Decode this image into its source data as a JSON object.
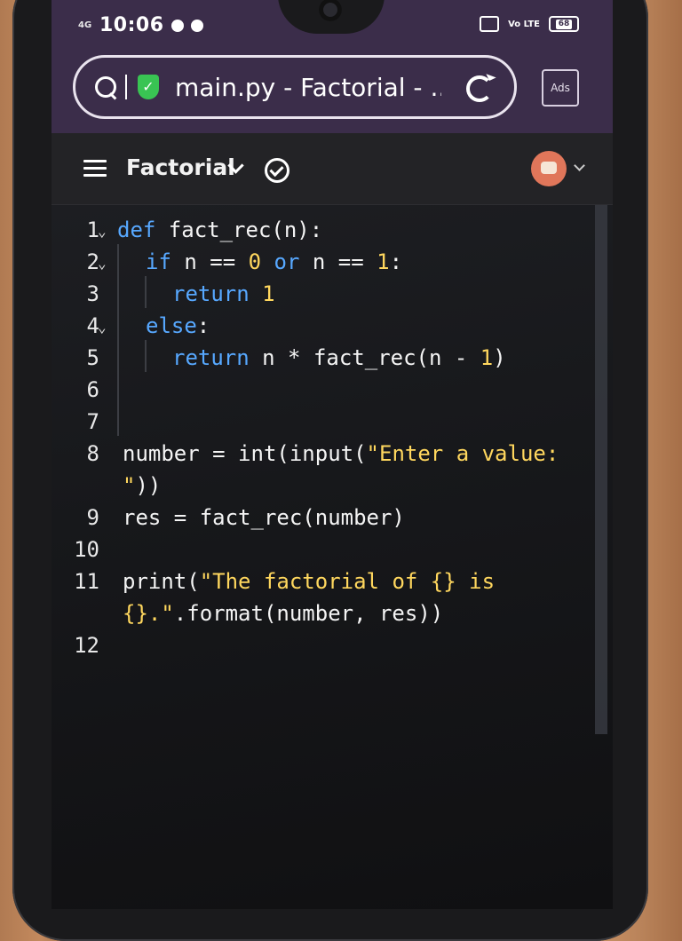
{
  "status_bar": {
    "network": "4G",
    "time": "10:06",
    "volte": "Vo LTE",
    "battery": "68"
  },
  "browser": {
    "url_text": "main.py - Factorial - ...",
    "ads_label": "Ads",
    "secure_icon": "shield-check-icon"
  },
  "app_header": {
    "project_title": "Factorial"
  },
  "colors": {
    "keyword": "#57a8ff",
    "string_number": "#ffd75e",
    "plain": "#f4f4f4"
  },
  "code_lines": [
    {
      "n": "1",
      "segments": [
        [
          "kw",
          "def "
        ],
        [
          "fn",
          "fact_rec(n):"
        ]
      ]
    },
    {
      "n": "2",
      "segments": [
        [
          "kw",
          "if "
        ],
        [
          "fn",
          "n == "
        ],
        [
          "nm",
          "0"
        ],
        [
          "kw",
          " or "
        ],
        [
          "fn",
          "n == "
        ],
        [
          "nm",
          "1"
        ],
        [
          "fn",
          ":"
        ]
      ]
    },
    {
      "n": "3",
      "segments": [
        [
          "kw",
          "return "
        ],
        [
          "nm",
          "1"
        ]
      ]
    },
    {
      "n": "4",
      "segments": [
        [
          "kw",
          "else"
        ],
        [
          "fn",
          ":"
        ]
      ]
    },
    {
      "n": "5",
      "segments": [
        [
          "kw",
          "return "
        ],
        [
          "fn",
          "n * fact_rec(n - "
        ],
        [
          "nm",
          "1"
        ],
        [
          "fn",
          ")"
        ]
      ]
    },
    {
      "n": "6",
      "segments": []
    },
    {
      "n": "7",
      "segments": []
    },
    {
      "n": "8",
      "segments": [
        [
          "fn",
          "number = int(input("
        ],
        [
          "st",
          "\"Enter a value:"
        ]
      ]
    },
    {
      "n": "",
      "segments": [
        [
          "st",
          "\""
        ],
        [
          "fn",
          "))"
        ]
      ]
    },
    {
      "n": "9",
      "segments": [
        [
          "fn",
          "res = fact_rec(number)"
        ]
      ]
    },
    {
      "n": "10",
      "segments": []
    },
    {
      "n": "11",
      "segments": [
        [
          "fn",
          "print("
        ],
        [
          "st",
          "\"The factorial of {} is"
        ]
      ]
    },
    {
      "n": "",
      "segments": [
        [
          "st",
          "{}.\""
        ],
        [
          "fn",
          ".format(number, res))"
        ]
      ]
    },
    {
      "n": "12",
      "segments": []
    }
  ]
}
